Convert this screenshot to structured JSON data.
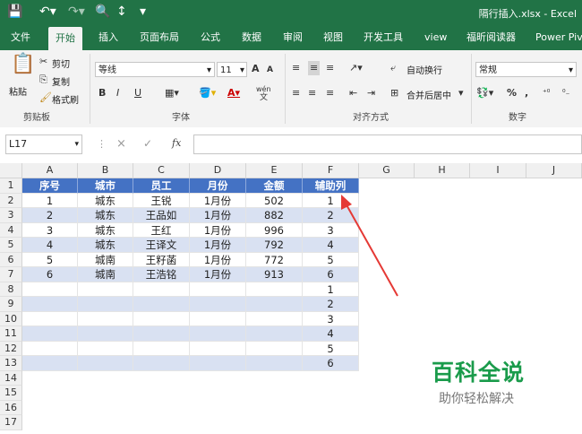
{
  "titlebar": {
    "title": "隔行插入.xlsx  -  Excel"
  },
  "tabs": [
    "文件",
    "开始",
    "插入",
    "页面布局",
    "公式",
    "数据",
    "审阅",
    "视图",
    "开发工具",
    "view",
    "福昕阅读器",
    "Power Pivot"
  ],
  "active_tab": "开始",
  "ribbon": {
    "clipboard": {
      "paste": "粘贴",
      "cut": "剪切",
      "copy": "复制",
      "format_painter": "格式刷",
      "label": "剪贴板"
    },
    "font": {
      "name": "等线",
      "size": "11",
      "bold": "B",
      "italic": "I",
      "underline": "U",
      "grow": "A",
      "shrink": "A",
      "wen": "wén",
      "wen_char": "文",
      "label": "字体"
    },
    "alignment": {
      "wrap": "自动换行",
      "merge": "合并后居中",
      "label": "对齐方式"
    },
    "number": {
      "format": "常规",
      "percent": "%",
      "comma": ",",
      "label": "数字"
    }
  },
  "formula_bar": {
    "name_box": "L17",
    "cancel": "×",
    "enter": "✓",
    "fx": "fx",
    "value": ""
  },
  "columns": [
    "A",
    "B",
    "C",
    "D",
    "E",
    "F",
    "G",
    "H",
    "I",
    "J"
  ],
  "rows": [
    "1",
    "2",
    "3",
    "4",
    "5",
    "6",
    "7",
    "8",
    "9",
    "10",
    "11",
    "12",
    "13",
    "14",
    "15",
    "16",
    "17"
  ],
  "table": {
    "headers": [
      "序号",
      "城市",
      "员工",
      "月份",
      "金额",
      "辅助列"
    ],
    "data": [
      [
        "1",
        "城东",
        "王锐",
        "1月份",
        "502",
        "1"
      ],
      [
        "2",
        "城东",
        "王品如",
        "1月份",
        "882",
        "2"
      ],
      [
        "3",
        "城东",
        "王红",
        "1月份",
        "996",
        "3"
      ],
      [
        "4",
        "城东",
        "王译文",
        "1月份",
        "792",
        "4"
      ],
      [
        "5",
        "城南",
        "王籽菡",
        "1月份",
        "772",
        "5"
      ],
      [
        "6",
        "城南",
        "王浩铭",
        "1月份",
        "913",
        "6"
      ]
    ],
    "helper_tail": [
      "1",
      "2",
      "3",
      "4",
      "5",
      "6"
    ]
  },
  "watermark": {
    "line1": "百科全说",
    "line2": "助你轻松解决"
  },
  "colors": {
    "excel_green": "#217346",
    "header_blue": "#4472c4",
    "band_blue": "#d9e1f2",
    "arrow_red": "#e53935"
  }
}
